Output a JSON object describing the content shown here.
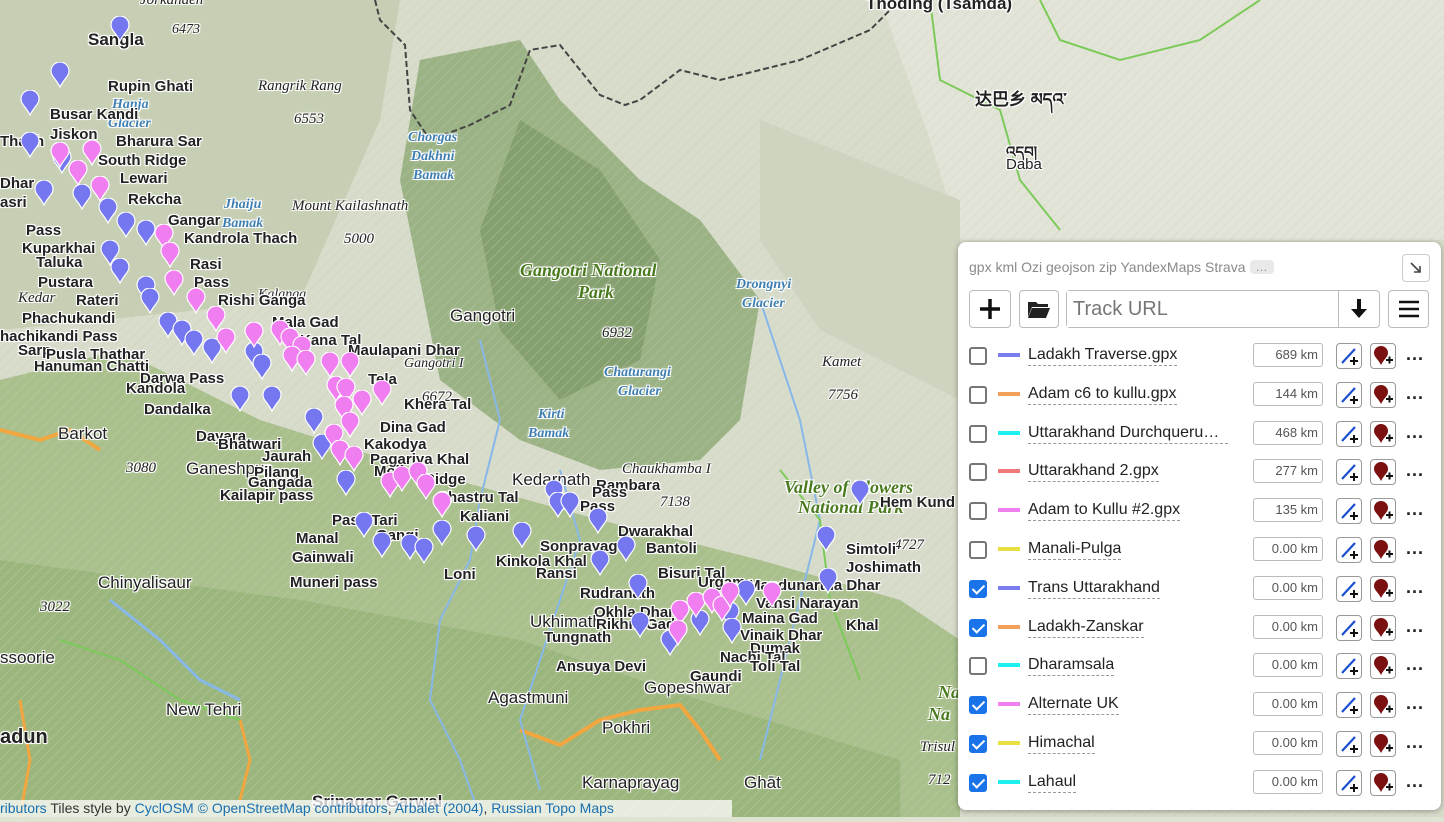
{
  "colors": {
    "blue": "#7a7cf0",
    "orange": "#f5a05a",
    "cyan": "#1ef0f0",
    "red": "#f07878",
    "magenta": "#f080f0",
    "yellow": "#e8e040",
    "pin_blue": "#7477f0",
    "pin_pink": "#f07ef0"
  },
  "map": {
    "labels": {
      "thoding": "Thoding (Tsamda)",
      "dabaxiang": "达巴乡 མདའ་",
      "daba_tib": "འདབ།",
      "daba": "Daba",
      "sangla": "Sangla",
      "sangla_peak": "6473",
      "jorkanden": "Jorkanden",
      "rupin_ghati": "Rupin Ghati",
      "hanja": "Hanja",
      "glacier_hanja": "Glacier",
      "busar_kandi": "Busar Kandi",
      "jiskon": "Jiskon",
      "bharura_sar": "Bharura Sar",
      "south_ridge": "South Ridge",
      "lewari": "Lewari",
      "rekcha": "Rekcha",
      "gangar": "Gangar",
      "kandrola": "Kandrola Thach",
      "rasi": "Rasi",
      "pass_a": "Pass",
      "rishi_ganga": "Rishi Ganga",
      "kalanga": "Kalanga",
      "thach": "Thach",
      "dhar": "Dhar",
      "asri": "asri",
      "pass_b": "Pass",
      "kuparkhai": "Kuparkhai",
      "taluka": "Taluka",
      "pustara": "Pustara",
      "kedar": "Kedar",
      "rateri": "Rateri",
      "phachukandi": "Phachukandi",
      "chachikandi": "hachikandi Pass",
      "sarp": "Sarp",
      "pusla": "Pusla Thathar",
      "hanuman": "Hanuman Chatti",
      "darwa": "Darwa Pass",
      "kandola": "Kandola",
      "dandalka": "Dandalka",
      "dayara": "Dayara",
      "bhatwari": "Bhatwari",
      "jaurah": "Jaurah",
      "ganeshpur": "Ganeshpur",
      "pilang": "Pilang",
      "gangada": "Gangada",
      "kailapir": "Kailapir pass",
      "barkot": "Barkot",
      "peak_3080": "3080",
      "chinyalisaur": "Chinyalisaur",
      "peak_3022": "3022",
      "mussoorie": "ssoorie",
      "new_tehri": "New Tehri",
      "dehradun": "adun",
      "rangrik": "Rangrik Rang",
      "peak_6553": "6553",
      "chorgas": "Chorgas",
      "dakhni": "Dakhni",
      "bamak_a": "Bamak",
      "jhaiju": "Jhaiju",
      "bamak_b": "Bamak",
      "mount_kailash": "Mount Kailashnath",
      "peak_5000": "5000",
      "gangotri": "Gangotri",
      "gangotri_np_1": "Gangotri National",
      "gangotri_np_2": "Park",
      "peak_6932": "6932",
      "drongnyi_1": "Drongnyi",
      "drongnyi_2": "Glacier",
      "kamet": "Kamet",
      "peak_7756": "7756",
      "chaturangi_1": "Chaturangi",
      "chaturangi_2": "Glacier",
      "kirti_1": "Kirti",
      "kirti_2": "Bamak",
      "mala_gad": "Mala Gad",
      "kana_tal": "Kana Tal",
      "maulapani": "Maulapani Dhar",
      "gangotri_i": "Gangotri I",
      "tela": "Tela",
      "peak_6672": "6672",
      "khera_tal": "Khera Tal",
      "dina_gad": "Dina Gad",
      "kakodya": "Kakodya",
      "pagariya": "Pagariya Khal",
      "moli": "Moli",
      "ridge": "Ridge",
      "shastru_tal": "Shastru Tal",
      "kaliani": "Kaliani",
      "pass_tari": "Pass Tari",
      "gangi": "Gangi",
      "manal": "Manal",
      "gainwali": "Gainwali",
      "muneri": "Muneri pass",
      "loni": "Loni",
      "kedarnath": "Kedarnath",
      "rambara": "Rambara",
      "pass_c": "Pass",
      "pass_d": "Pass",
      "chaukhamba": "Chaukhamba I",
      "peak_7138": "7138",
      "dwarakhal": "Dwarakhal",
      "bantoli": "Bantoli",
      "kinkola": "Kinkola Khal",
      "sonprayag": "Sonprayag",
      "ransi": "Ransi",
      "bisuri": "Bisuri Tal",
      "urgam": "Urgam",
      "rudranath": "Rudranath",
      "okhla": "Okhla Dhar",
      "ukhimath": "Ukhimath",
      "rikhni": "Rikhni Gad",
      "tungnath": "Tungnath",
      "ansuya": "Ansuya Devi",
      "gopeshwar": "Gopeshwar",
      "agastmuni": "Agastmuni",
      "pokhri": "Pokhri",
      "karnaprayag": "Karnaprayag",
      "ghat": "Ghāt",
      "srinagar": "Srinagar Garwal",
      "mandunartha": "Mandunartha Dhar",
      "vansi_narayan": "Vansi Narayan",
      "maina_gad": "Maina Gad",
      "khal": "Khal",
      "vinaik": "Vinaik Dhar",
      "dumak": "Dumak",
      "nachi": "Nachi Tal",
      "toli_tal": "Toli Tal",
      "gaundi": "Gaundi",
      "valley_1": "Valley of Flowers",
      "valley_2": "National Park",
      "hem_kund": "Hem Kund",
      "peak_4727": "4727",
      "simtoli": "Simtoli",
      "joshimath": "Joshimath",
      "trisul": "Trisul",
      "peak_712": "712",
      "na_1": "Na",
      "na_2": "Na"
    },
    "attribution": {
      "prefix": "ributors",
      "tiles": "Tiles style by",
      "cyclosm": "CyclOSM",
      "osm": "© OpenStreetMap contributors",
      "arbalet": "Arbalet (2004)",
      "topo": "Russian Topo Maps"
    }
  },
  "panel": {
    "formats": "gpx kml Ozi geojson zip YandexMaps Strava",
    "more": "…",
    "minimize_icon": "arrow-down-right",
    "url_placeholder": "Track URL",
    "tracks": [
      {
        "name": "Ladakh Traverse.gpx",
        "color": "#7a7cf0",
        "distance": "689 km",
        "checked": false
      },
      {
        "name": "Adam c6 to kullu.gpx",
        "color": "#f5a05a",
        "distance": "144 km",
        "checked": false
      },
      {
        "name": "Uttarakhand Durchquerung...",
        "color": "#1ef0f0",
        "distance": "468 km",
        "checked": false
      },
      {
        "name": "Uttarakhand 2.gpx",
        "color": "#f07878",
        "distance": "277 km",
        "checked": false
      },
      {
        "name": "Adam to Kullu #2.gpx",
        "color": "#f080f0",
        "distance": "135 km",
        "checked": false
      },
      {
        "name": "Manali-Pulga",
        "color": "#e8e040",
        "distance": "0.00 km",
        "checked": false
      },
      {
        "name": "Trans Uttarakhand",
        "color": "#7a7cf0",
        "distance": "0.00 km",
        "checked": true
      },
      {
        "name": "Ladakh-Zanskar",
        "color": "#f5a05a",
        "distance": "0.00 km",
        "checked": true
      },
      {
        "name": "Dharamsala",
        "color": "#1ef0f0",
        "distance": "0.00 km",
        "checked": false
      },
      {
        "name": "Alternate UK",
        "color": "#f080f0",
        "distance": "0.00 km",
        "checked": true
      },
      {
        "name": "Himachal",
        "color": "#e8e040",
        "distance": "0.00 km",
        "checked": true
      },
      {
        "name": "Lahaul",
        "color": "#1ef0f0",
        "distance": "0.00 km",
        "checked": true
      }
    ],
    "row_more": "..."
  }
}
